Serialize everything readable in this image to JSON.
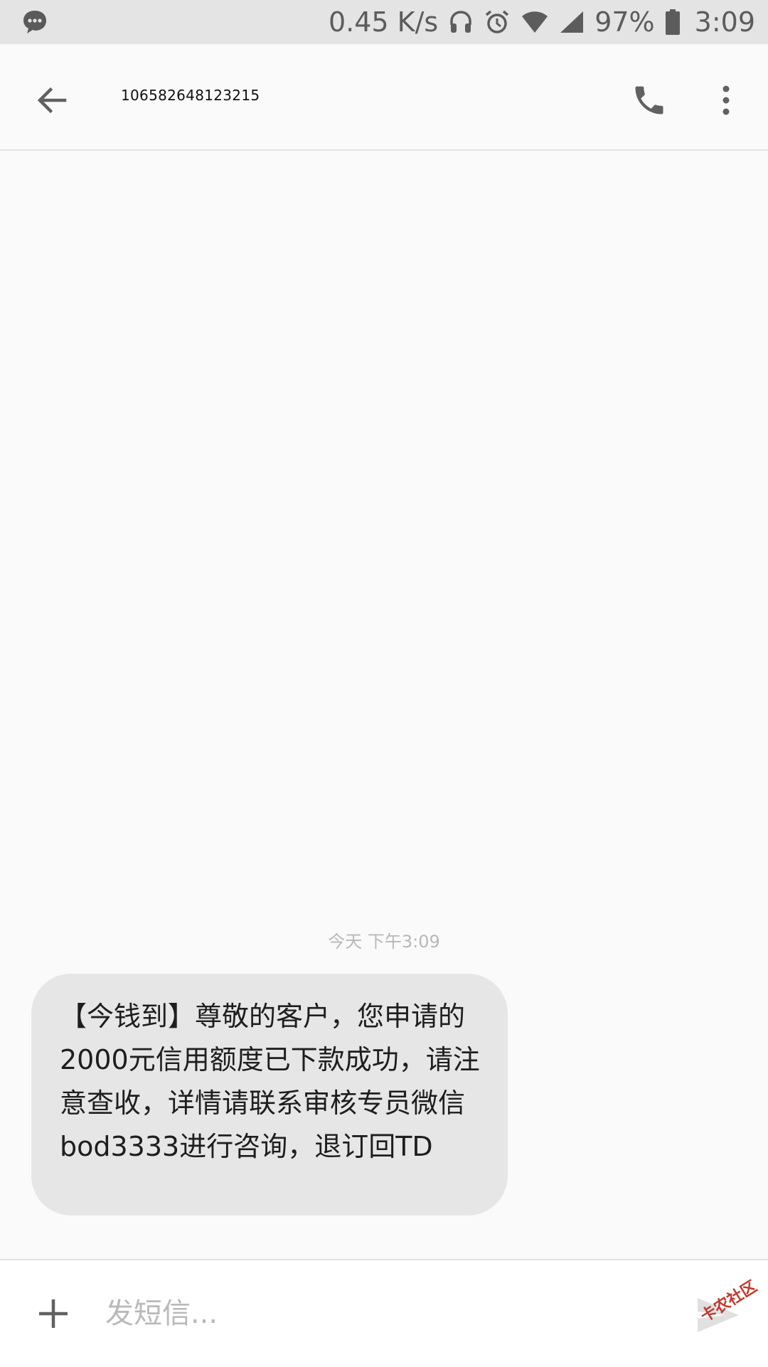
{
  "status_bar": {
    "net_speed": "0.45 K/s",
    "battery": "97%",
    "time": "3:09"
  },
  "header": {
    "title": "106582648123215"
  },
  "conversation": {
    "timestamp": "今天 下午3:09",
    "message": "【今钱到】尊敬的客户，您申请的2000元信用额度已下款成功，请注意查收，详情请联系审核专员微信bod3333进行咨询，退订回TD"
  },
  "compose": {
    "placeholder": "发短信..."
  },
  "watermark": {
    "text": "卡农社区"
  },
  "colors": {
    "background": "#fafafa",
    "status_bar": "#e4e4e4",
    "bubble": "#e6e6e6",
    "icon": "#616161"
  }
}
